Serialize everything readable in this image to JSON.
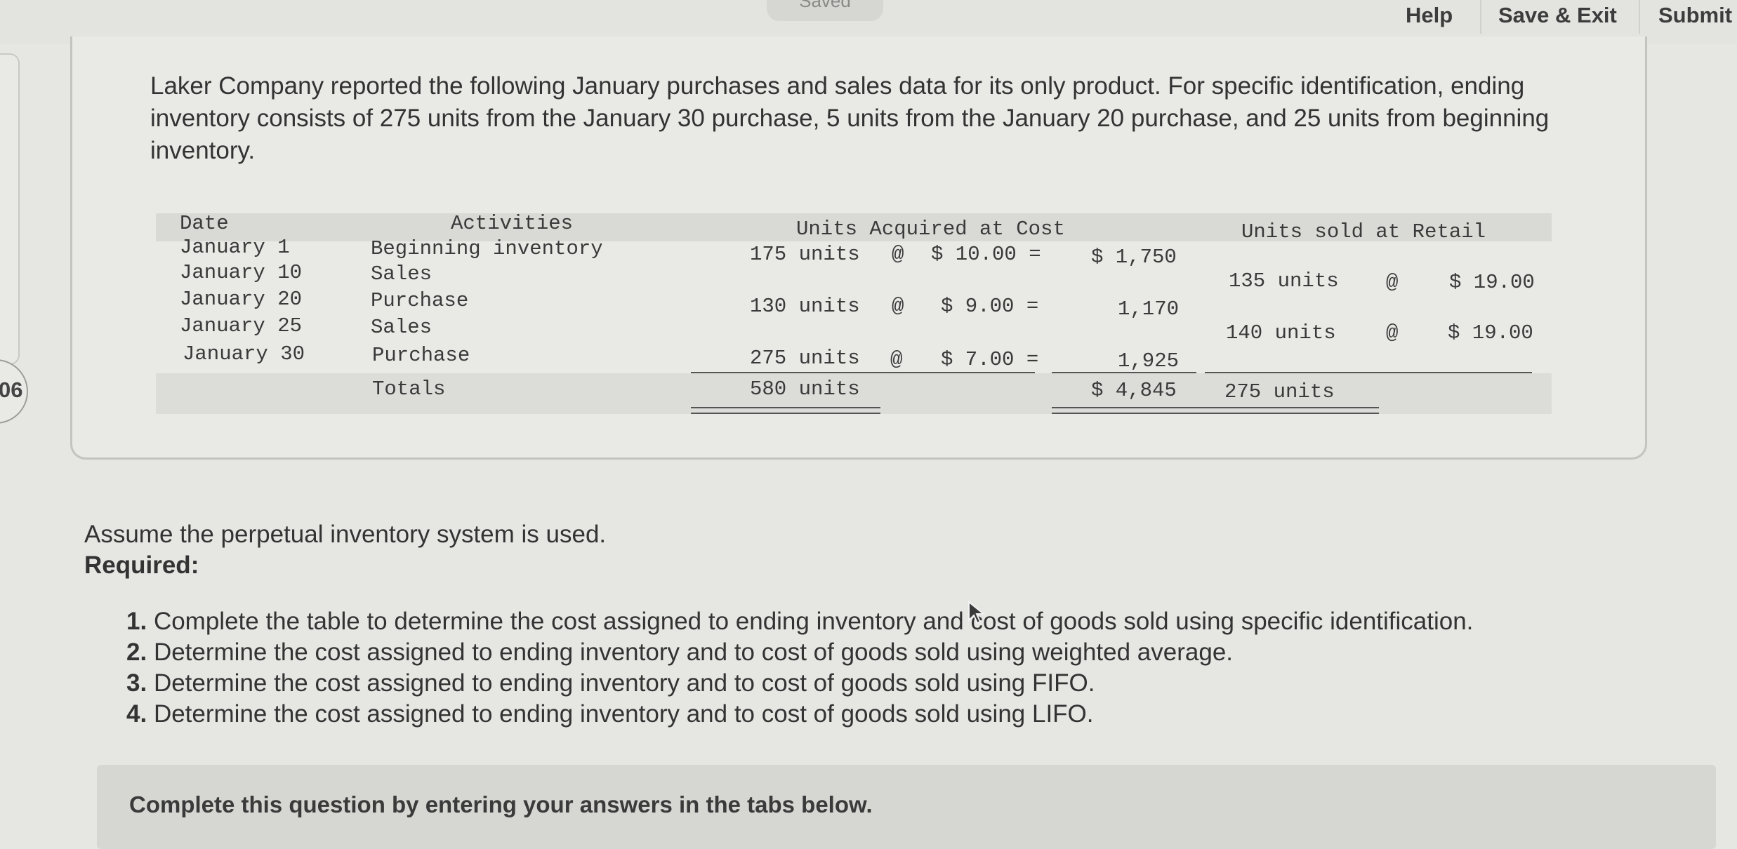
{
  "header": {
    "saved_label": "Saved",
    "help": "Help",
    "save_exit": "Save & Exit",
    "submit": "Submit"
  },
  "question_number": "06",
  "intro": "Laker Company reported the following January purchases and sales data for its only product. For specific identification, ending inventory consists of 275 units from the January 30 purchase, 5 units from the January 20 purchase, and 25 units from beginning inventory.",
  "table": {
    "headers": {
      "date": "Date",
      "activities": "Activities",
      "acquired": "Units Acquired at Cost",
      "sold": "Units sold at Retail"
    },
    "rows": [
      {
        "date": "January 1",
        "activity": "Beginning inventory",
        "acq_units": "175 units",
        "acq_at": "@",
        "acq_cost": "$ 10.00 =",
        "acq_total": "$ 1,750",
        "sold_units": "",
        "sold_at": "",
        "sold_price": ""
      },
      {
        "date": "January 10",
        "activity": "Sales",
        "acq_units": "",
        "acq_at": "",
        "acq_cost": "",
        "acq_total": "",
        "sold_units": "135 units",
        "sold_at": "@",
        "sold_price": "$ 19.00"
      },
      {
        "date": "January 20",
        "activity": "Purchase",
        "acq_units": "130 units",
        "acq_at": "@",
        "acq_cost": "$ 9.00 =",
        "acq_total": "1,170",
        "sold_units": "",
        "sold_at": "",
        "sold_price": ""
      },
      {
        "date": "January 25",
        "activity": "Sales",
        "acq_units": "",
        "acq_at": "",
        "acq_cost": "",
        "acq_total": "",
        "sold_units": "140 units",
        "sold_at": "@",
        "sold_price": "$ 19.00"
      },
      {
        "date": "January 30",
        "activity": "Purchase",
        "acq_units": "275 units",
        "acq_at": "@",
        "acq_cost": "$ 7.00 =",
        "acq_total": "1,925",
        "sold_units": "",
        "sold_at": "",
        "sold_price": ""
      }
    ],
    "totals": {
      "label": "Totals",
      "acq_units": "580 units",
      "acq_total": "$ 4,845",
      "sold_units": "275 units"
    }
  },
  "assume": "Assume the perpetual inventory system is used.",
  "required_label": "Required:",
  "requirements": [
    {
      "num": "1.",
      "text": "Complete the table to determine the cost assigned to ending inventory and cost of goods sold using specific identification."
    },
    {
      "num": "2.",
      "text": "Determine the cost assigned to ending inventory and to cost of goods sold using weighted average."
    },
    {
      "num": "3.",
      "text": "Determine the cost assigned to ending inventory and to cost of goods sold using FIFO."
    },
    {
      "num": "4.",
      "text": "Determine the cost assigned to ending inventory and to cost of goods sold using LIFO."
    }
  ],
  "bottom_instruction": "Complete this question by entering your answers in the tabs below."
}
